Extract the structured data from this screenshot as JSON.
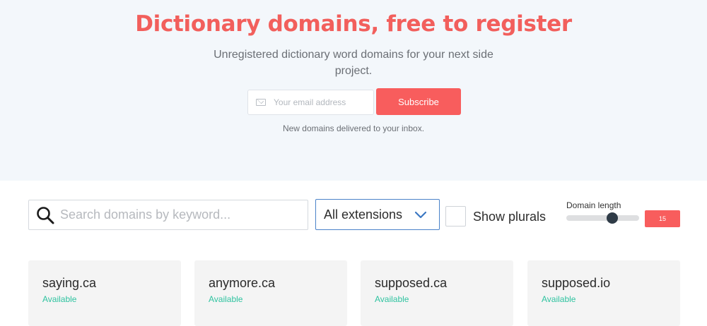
{
  "hero": {
    "title": "Dictionary domains, free to register",
    "subtitle": "Unregistered dictionary word domains for your next side project.",
    "email_placeholder": "Your email address",
    "subscribe_label": "Subscribe",
    "note": "New domains delivered to your inbox."
  },
  "filters": {
    "search_placeholder": "Search domains by keyword...",
    "extension_selected": "All extensions",
    "plurals_label": "Show plurals",
    "plurals_checked": false,
    "length_label": "Domain length",
    "length_value": "15",
    "length_fraction": 0.63
  },
  "domains": [
    {
      "name": "saying.ca",
      "status": "Available"
    },
    {
      "name": "anymore.ca",
      "status": "Available"
    },
    {
      "name": "supposed.ca",
      "status": "Available"
    },
    {
      "name": "supposed.io",
      "status": "Available"
    }
  ],
  "colors": {
    "accent": "#f85d5d",
    "title": "#f25f5c",
    "available": "#2fc3a0",
    "hero_bg": "#f3f7fb",
    "select_border": "#4a82c9"
  },
  "icons": {
    "email": "envelope-icon",
    "search": "magnifier-icon",
    "dropdown": "chevron-down-icon"
  }
}
